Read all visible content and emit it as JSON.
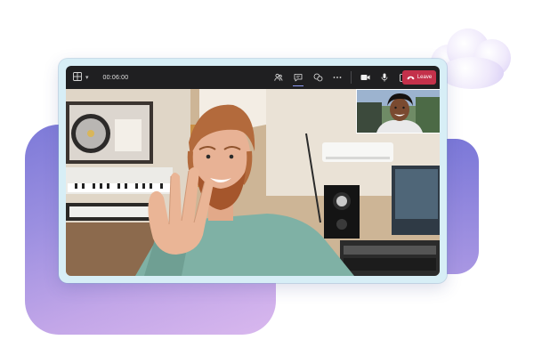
{
  "call": {
    "timer": "00:06:00",
    "leave_label": "Leave"
  },
  "toolbar": {
    "icons": [
      "layout-grid-icon",
      "people-icon",
      "chat-icon",
      "reactions-icon",
      "more-icon",
      "camera-icon",
      "mic-icon",
      "share-icon",
      "phone-icon"
    ]
  },
  "colors": {
    "titlebar": "#1f1f21",
    "leave": "#c4314b",
    "accent": "#8f9cf5",
    "blob": "#8b86dc"
  }
}
